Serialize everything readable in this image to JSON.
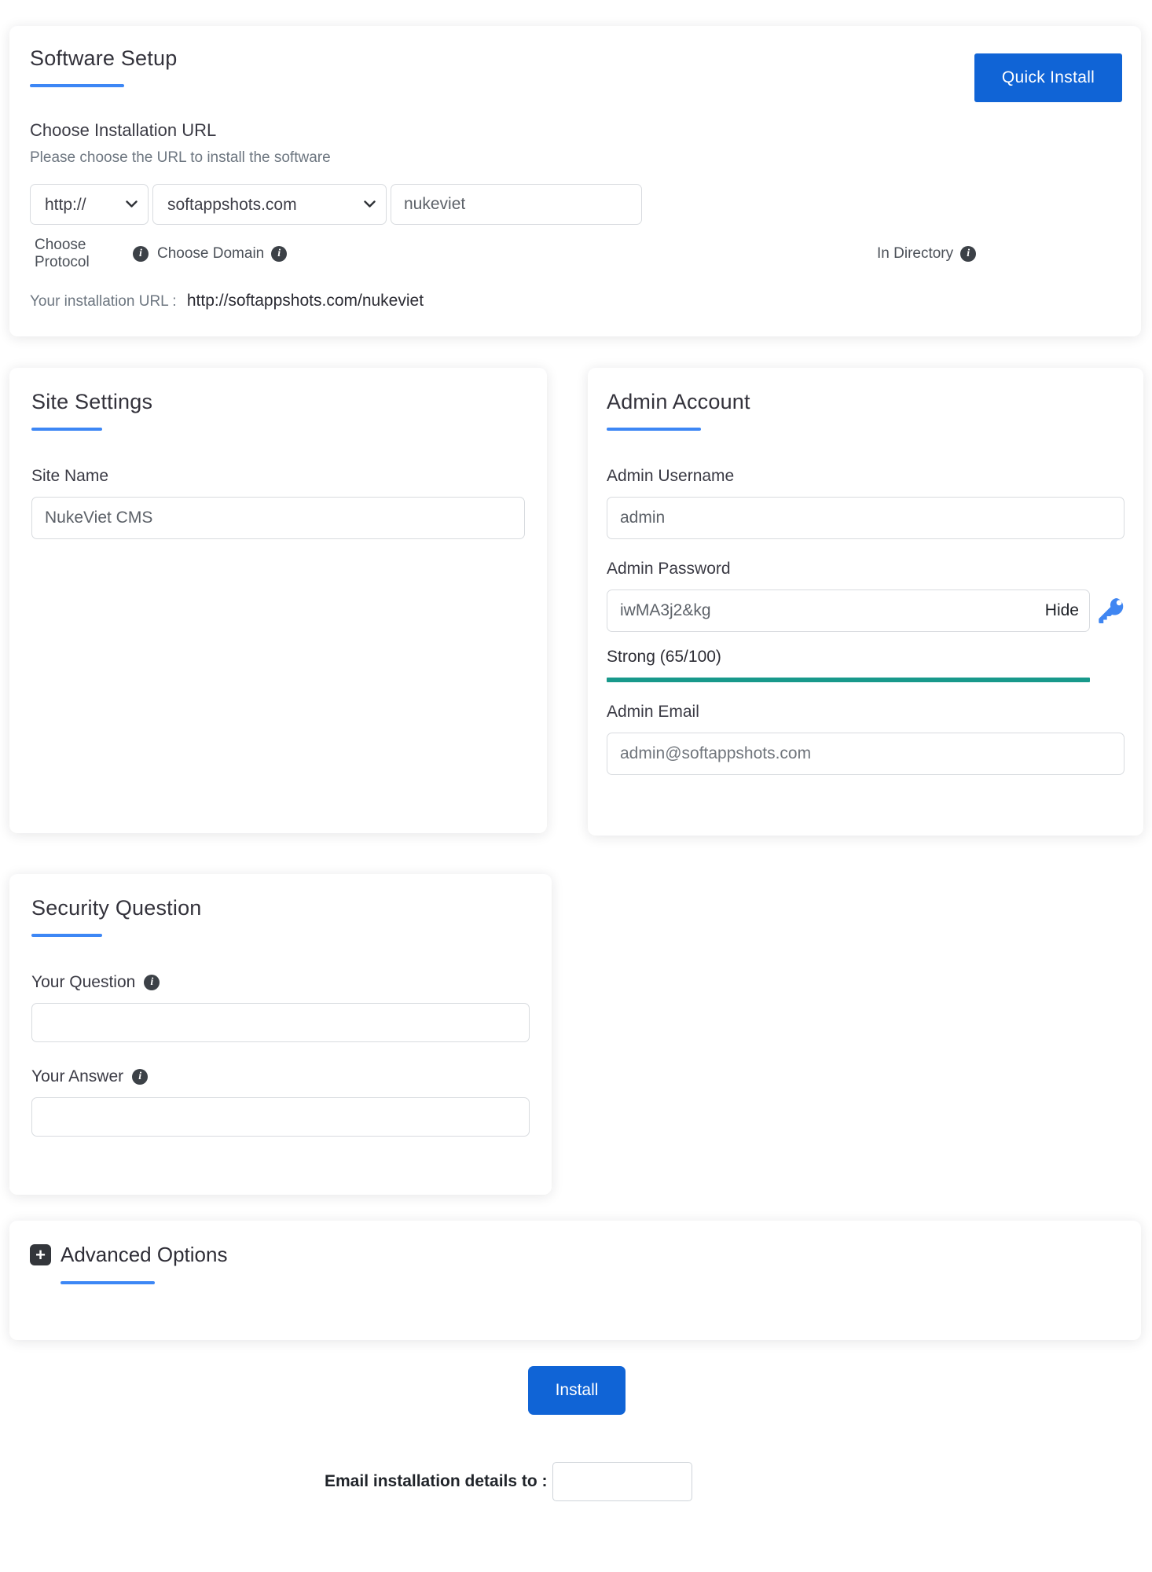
{
  "software_setup": {
    "title": "Software Setup",
    "quick_install_label": "Quick Install",
    "section_title": "Choose Installation URL",
    "section_subtitle": "Please choose the URL to install the software",
    "protocol": {
      "value": "http://",
      "label": "Choose Protocol"
    },
    "domain": {
      "value": "softappshots.com",
      "label": "Choose Domain"
    },
    "directory": {
      "value": "nukeviet",
      "label": "In Directory"
    },
    "installation_url_label": "Your installation URL :",
    "installation_url": "http://softappshots.com/nukeviet"
  },
  "site_settings": {
    "title": "Site Settings",
    "site_name_label": "Site Name",
    "site_name_value": "NukeViet CMS"
  },
  "admin_account": {
    "title": "Admin Account",
    "username_label": "Admin Username",
    "username_value": "admin",
    "password_label": "Admin Password",
    "password_value": "iwMA3j2&kg",
    "hide_label": "Hide",
    "strength_text": "Strong (65/100)",
    "strength_score": 65,
    "strength_max": 100,
    "email_label": "Admin Email",
    "email_value": "admin@softappshots.com"
  },
  "security_question": {
    "title": "Security Question",
    "question_label": "Your Question",
    "question_value": "",
    "answer_label": "Your Answer",
    "answer_value": ""
  },
  "advanced_options": {
    "title": "Advanced Options"
  },
  "footer": {
    "install_label": "Install",
    "email_details_label": "Email installation details to :",
    "email_details_value": ""
  },
  "icons": {
    "info_glyph": "i",
    "plus_glyph": "+"
  },
  "colors": {
    "primary_blue": "#1064d6",
    "underline_blue": "#3d87f5",
    "strength_teal": "#18998b",
    "key_icon_blue": "#3f86f2"
  }
}
